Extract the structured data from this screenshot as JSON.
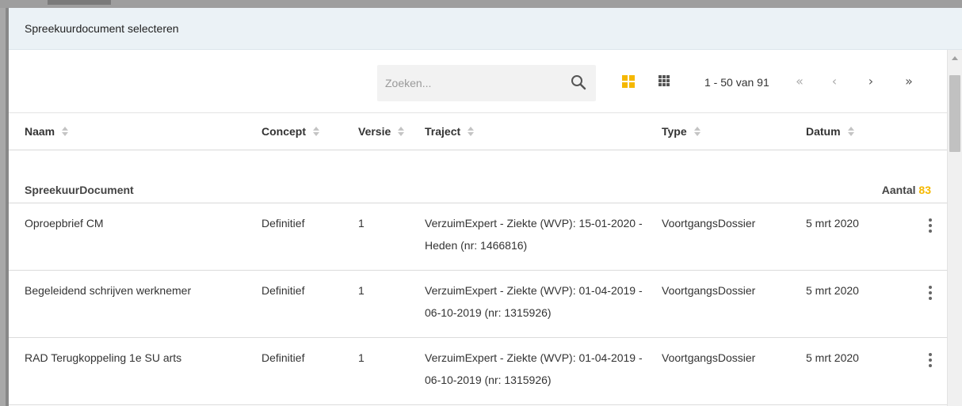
{
  "dialog": {
    "title": "Spreekuurdocument selecteren"
  },
  "search": {
    "placeholder": "Zoeken...",
    "value": ""
  },
  "view_toggle": {
    "grid_icon": "grid-view-icon",
    "list_icon": "list-view-icon",
    "active_color": "#f5b800"
  },
  "pager": {
    "range_label": "1 - 50 van 91",
    "first": "«",
    "prev": "‹",
    "next": "›",
    "last": "»"
  },
  "table": {
    "columns": [
      "Naam",
      "Concept",
      "Versie",
      "Traject",
      "Type",
      "Datum"
    ],
    "group": {
      "label": "SpreekuurDocument",
      "count_label": "Aantal",
      "count": "83"
    },
    "rows": [
      {
        "naam": "Oproepbrief CM",
        "concept": "Definitief",
        "versie": "1",
        "traject": "VerzuimExpert - Ziekte (WVP): 15-01-2020 - Heden (nr: 1466816)",
        "type": "VoortgangsDossier",
        "datum": "5 mrt 2020"
      },
      {
        "naam": "Begeleidend schrijven werknemer",
        "concept": "Definitief",
        "versie": "1",
        "traject": "VerzuimExpert - Ziekte (WVP): 01-04-2019 - 06-10-2019 (nr: 1315926)",
        "type": "VoortgangsDossier",
        "datum": "5 mrt 2020"
      },
      {
        "naam": "RAD Terugkoppeling 1e SU arts",
        "concept": "Definitief",
        "versie": "1",
        "traject": "VerzuimExpert - Ziekte (WVP): 01-04-2019 - 06-10-2019 (nr: 1315926)",
        "type": "VoortgangsDossier",
        "datum": "5 mrt 2020"
      }
    ]
  },
  "colors": {
    "header_bg": "#ebf2f6",
    "accent": "#f5b800"
  }
}
